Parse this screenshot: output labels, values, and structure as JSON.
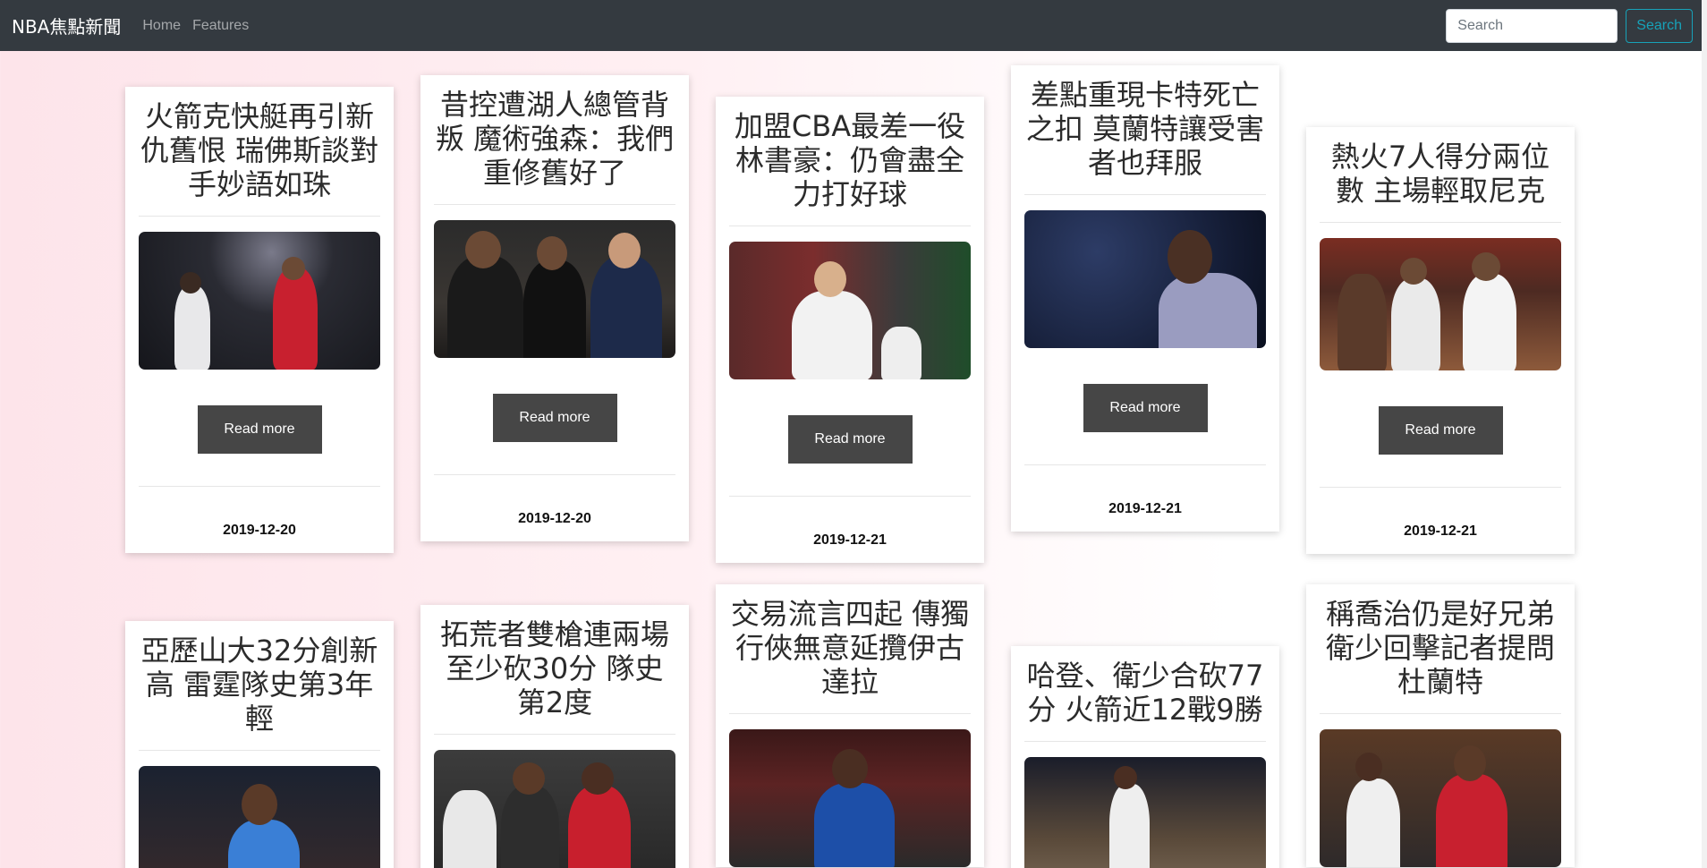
{
  "navbar": {
    "brand": "NBA焦點新聞",
    "links": [
      "Home",
      "Features"
    ],
    "search_placeholder": "Search",
    "search_button": "Search"
  },
  "articles": [
    {
      "title": "火箭克快艇再引新仇舊恨 瑞佛斯談對手妙語如珠",
      "read_more": "Read more",
      "date": "2019-12-20",
      "image": "photo-westbrook-rockets"
    },
    {
      "title": "昔控遭湖人總管背叛 魔術強森：我們重修舊好了",
      "read_more": "Read more",
      "date": "2019-12-20",
      "image": "photo-magic-kobe-pelinka"
    },
    {
      "title": "加盟CBA最差一役 林書豪：仍會盡全力打好球",
      "read_more": "Read more",
      "date": "2019-12-21",
      "image": "photo-jeremy-lin"
    },
    {
      "title": "差點重現卡特死亡之扣 莫蘭特讓受害者也拜服",
      "read_more": "Read more",
      "date": "2019-12-21",
      "image": "photo-ja-morant"
    },
    {
      "title": "熱火7人得分兩位數 主場輕取尼克",
      "read_more": "Read more",
      "date": "2019-12-21",
      "image": "photo-heat-players"
    },
    {
      "title": "亞歷山大32分創新高 雷霆隊史第3年輕",
      "image": "photo-gilgeous-alexander"
    },
    {
      "title": "拓荒者雙槍連兩場至少砍30分 隊史第2度",
      "image": "photo-blazers-duo"
    },
    {
      "title": "交易流言四起 傳獨行俠無意延攬伊古達拉",
      "image": "photo-iguodala"
    },
    {
      "title": "哈登、衛少合砍77分 火箭近12戰9勝",
      "image": "photo-harden-dunk"
    },
    {
      "title": "稱喬治仍是好兄弟 衛少回擊記者提問杜蘭特",
      "image": "photo-westbrook-clippers"
    }
  ]
}
